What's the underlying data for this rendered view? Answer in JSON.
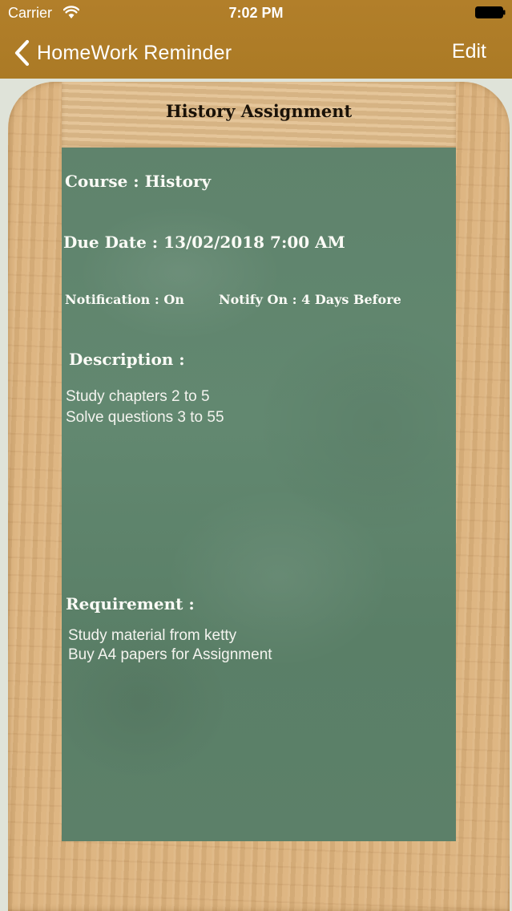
{
  "status_bar": {
    "carrier": "Carrier",
    "time": "7:02 PM",
    "wifi_icon": "wifi-icon",
    "battery_icon": "battery-icon"
  },
  "nav": {
    "back_label": "HomeWork Reminder",
    "back_icon": "chevron-left-icon",
    "edit_label": "Edit",
    "bar_color": "#ae7d28"
  },
  "assignment": {
    "title": "History Assignment",
    "course_line": "Course : History",
    "due_line": "Due Date : 13/02/2018 7:00 AM",
    "notification_line": "Notification : On",
    "notify_on_line": "Notify On : 4 Days Before",
    "description_label": "Description :",
    "description_body": "Study chapters 2 to 5\nSolve questions 3 to 55",
    "requirement_label": "Requirement :",
    "requirement_body": "Study material from ketty\nBuy A4 papers for Assignment"
  },
  "colors": {
    "chalkboard": "#5f836c",
    "wood": "#dcb27c"
  }
}
